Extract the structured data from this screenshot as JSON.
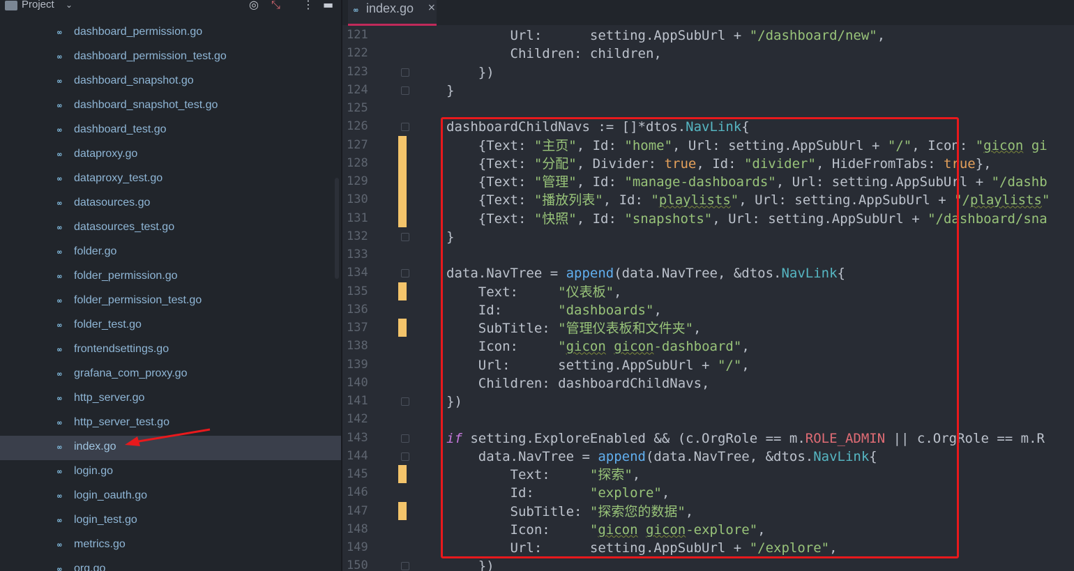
{
  "sidebar": {
    "title": "Project",
    "header_icons": [
      "target-icon",
      "collapse-icon",
      "more-icon",
      "minimize-icon"
    ],
    "files": [
      {
        "name": "dashboard_permission.go"
      },
      {
        "name": "dashboard_permission_test.go"
      },
      {
        "name": "dashboard_snapshot.go"
      },
      {
        "name": "dashboard_snapshot_test.go"
      },
      {
        "name": "dashboard_test.go"
      },
      {
        "name": "dataproxy.go"
      },
      {
        "name": "dataproxy_test.go"
      },
      {
        "name": "datasources.go"
      },
      {
        "name": "datasources_test.go"
      },
      {
        "name": "folder.go"
      },
      {
        "name": "folder_permission.go"
      },
      {
        "name": "folder_permission_test.go"
      },
      {
        "name": "folder_test.go"
      },
      {
        "name": "frontendsettings.go"
      },
      {
        "name": "grafana_com_proxy.go"
      },
      {
        "name": "http_server.go"
      },
      {
        "name": "http_server_test.go"
      },
      {
        "name": "index.go",
        "selected": true
      },
      {
        "name": "login.go"
      },
      {
        "name": "login_oauth.go"
      },
      {
        "name": "login_test.go"
      },
      {
        "name": "metrics.go"
      },
      {
        "name": "org.go"
      }
    ],
    "go_icon_glyph": "∞"
  },
  "editor": {
    "tab": {
      "label": "index.go",
      "close": "×",
      "icon": "∞"
    },
    "accent_color": "#c02a5a",
    "annotation_color": "#e8191c",
    "line_numbers": [
      "121",
      "122",
      "123",
      "124",
      "125",
      "126",
      "127",
      "128",
      "129",
      "130",
      "131",
      "132",
      "133",
      "134",
      "135",
      "136",
      "137",
      "138",
      "139",
      "140",
      "141",
      "142",
      "143",
      "144",
      "145",
      "146",
      "147",
      "148",
      "149",
      "150"
    ],
    "code_lines": [
      "        Url:      setting.AppSubUrl + \"/dashboard/new\",",
      "        Children: children,",
      "    })",
      "}",
      "",
      "dashboardChildNavs := []*dtos.NavLink{",
      "    {Text: \"主页\", Id: \"home\", Url: setting.AppSubUrl + \"/\", Icon: \"gicon gi",
      "    {Text: \"分配\", Divider: true, Id: \"divider\", HideFromTabs: true},",
      "    {Text: \"管理\", Id: \"manage-dashboards\", Url: setting.AppSubUrl + \"/dashb",
      "    {Text: \"播放列表\", Id: \"playlists\", Url: setting.AppSubUrl + \"/playlists\"",
      "    {Text: \"快照\", Id: \"snapshots\", Url: setting.AppSubUrl + \"/dashboard/sna",
      "}",
      "",
      "data.NavTree = append(data.NavTree, &dtos.NavLink{",
      "    Text:     \"仪表板\",",
      "    Id:       \"dashboards\",",
      "    SubTitle: \"管理仪表板和文件夹\",",
      "    Icon:     \"gicon gicon-dashboard\",",
      "    Url:      setting.AppSubUrl + \"/\",",
      "    Children: dashboardChildNavs,",
      "})",
      "",
      "if setting.ExploreEnabled && (c.OrgRole == m.ROLE_ADMIN || c.OrgRole == m.R",
      "    data.NavTree = append(data.NavTree, &dtos.NavLink{",
      "        Text:     \"探索\",",
      "        Id:       \"explore\",",
      "        SubTitle: \"探索您的数据\",",
      "        Icon:     \"gicon gicon-explore\",",
      "        Url:      setting.AppSubUrl + \"/explore\",",
      "    })"
    ],
    "modified_lines": [
      "127",
      "128",
      "129",
      "130",
      "131",
      "135",
      "137",
      "145",
      "147"
    ],
    "fold_lines": [
      "123",
      "124",
      "126",
      "132",
      "134",
      "141",
      "143",
      "144",
      "150"
    ]
  }
}
